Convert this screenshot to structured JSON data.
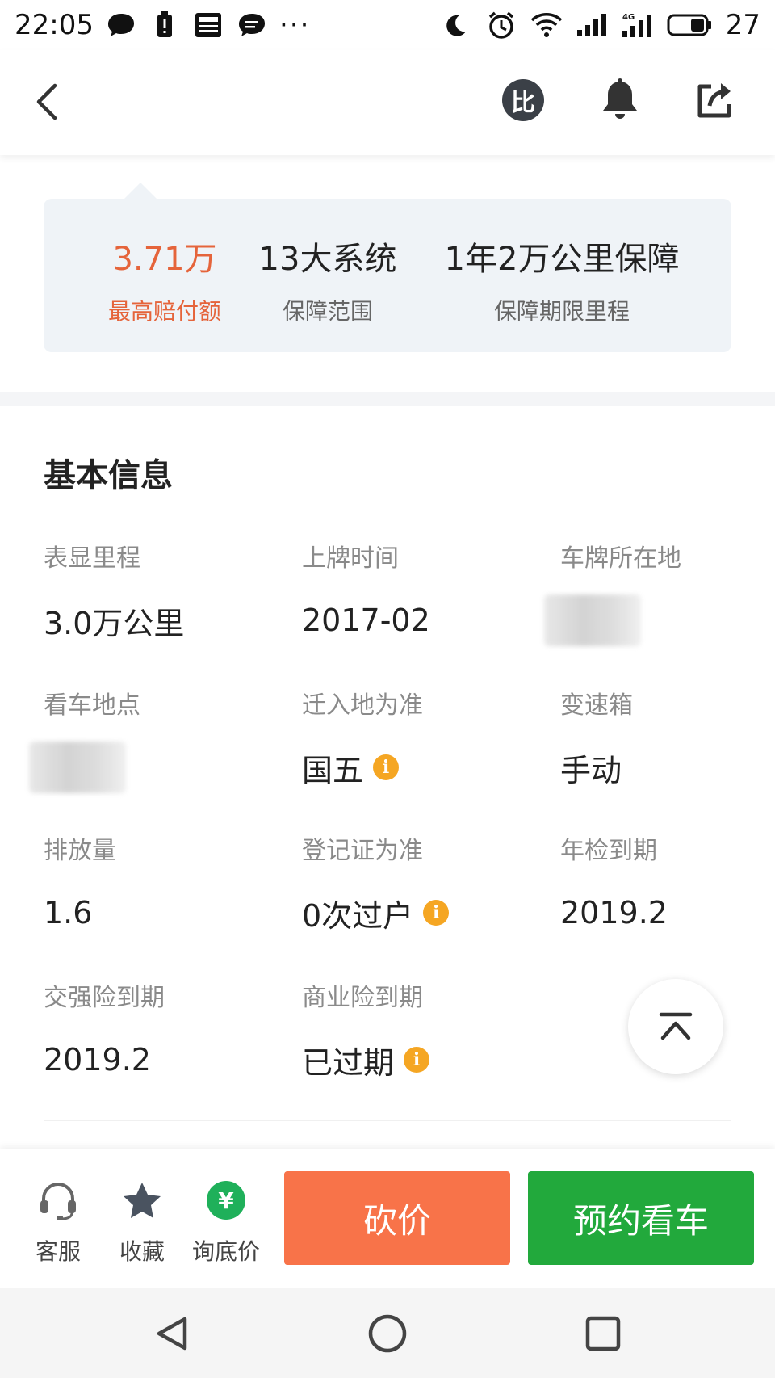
{
  "status_bar": {
    "time": "22:05",
    "battery_level": "27"
  },
  "guarantee": {
    "items": [
      {
        "value": "3.71万",
        "label": "最高赔付额",
        "highlight": true
      },
      {
        "value": "13大系统",
        "label": "保障范围"
      },
      {
        "value": "1年2万公里保障",
        "label": "保障期限里程"
      }
    ]
  },
  "basic_info": {
    "title": "基本信息",
    "rows": [
      [
        {
          "label": "表显里程",
          "value": "3.0万公里"
        },
        {
          "label": "上牌时间",
          "value": "2017-02"
        },
        {
          "label": "车牌所在地",
          "value": "",
          "blurred": true
        }
      ],
      [
        {
          "label": "看车地点",
          "value": "",
          "blurred": true
        },
        {
          "label": "迁入地为准",
          "value": "国五",
          "info_icon": true
        },
        {
          "label": "变速箱",
          "value": "手动"
        }
      ],
      [
        {
          "label": "排放量",
          "value": "1.6"
        },
        {
          "label": "登记证为准",
          "value": "0次过户",
          "info_icon": true
        },
        {
          "label": "年检到期",
          "value": "2019.2"
        }
      ],
      [
        {
          "label": "交强险到期",
          "value": "2019.2"
        },
        {
          "label": "商业险到期",
          "value": "已过期",
          "info_icon": true
        }
      ]
    ]
  },
  "info_icon_glyph": "i",
  "action_bar": {
    "service_label": "客服",
    "favorite_label": "收藏",
    "lowest_price_label": "询底价",
    "yuan_glyph": "¥",
    "bargain_label": "砍价",
    "book_label": "预约看车"
  },
  "header": {
    "compare_glyph": "比"
  },
  "colors": {
    "accent_orange": "#e5643b",
    "bargain": "#f87349",
    "book": "#22a93c",
    "info": "#f5a623"
  }
}
